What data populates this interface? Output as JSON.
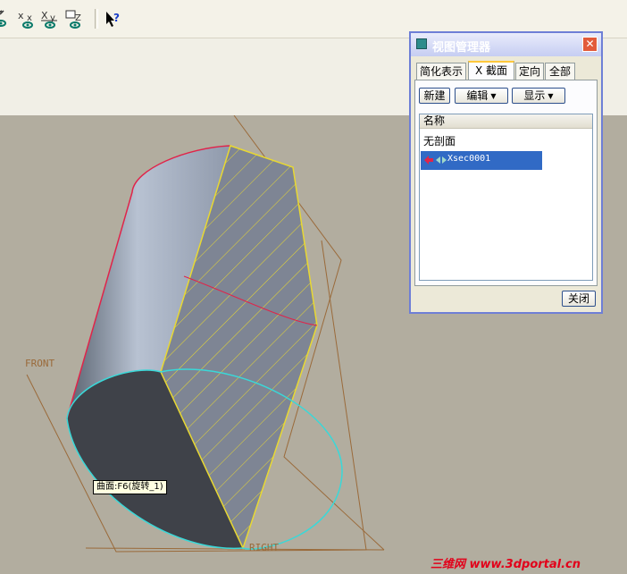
{
  "toolbar": {
    "icons": [
      "section-eye-icon",
      "section-x-eye-icon",
      "section-xy-eye-icon",
      "section-z-eye-icon",
      "context-help-icon"
    ]
  },
  "viewport": {
    "datum_labels": {
      "front": "FRONT",
      "right": "RIGHT"
    },
    "tooltip": "曲面:F6(旋转_1)"
  },
  "dialog": {
    "title": "视图管理器",
    "close_glyph": "✕",
    "tabs": [
      "简化表示",
      "X 截面",
      "定向",
      "全部"
    ],
    "active_tab": "X 截面",
    "buttons": {
      "new": "新建",
      "edit": "编辑",
      "display": "显示"
    },
    "list": {
      "header": "名称",
      "items": [
        "无剖面",
        "Xsec0001"
      ],
      "selected": "Xsec0001"
    },
    "close_label": "关闭"
  },
  "watermark": "三维网 www.3dportal.cn",
  "colors": {
    "accent_blue": "#316ac5",
    "title_bar": "#c6cdf2",
    "close_button": "#e25b3b",
    "datum_plane": "#9a6a3a",
    "section_edge": "#e8d832",
    "curve_red": "#e0244a",
    "curve_cyan": "#3ad8d8",
    "watermark": "#e2001a"
  }
}
